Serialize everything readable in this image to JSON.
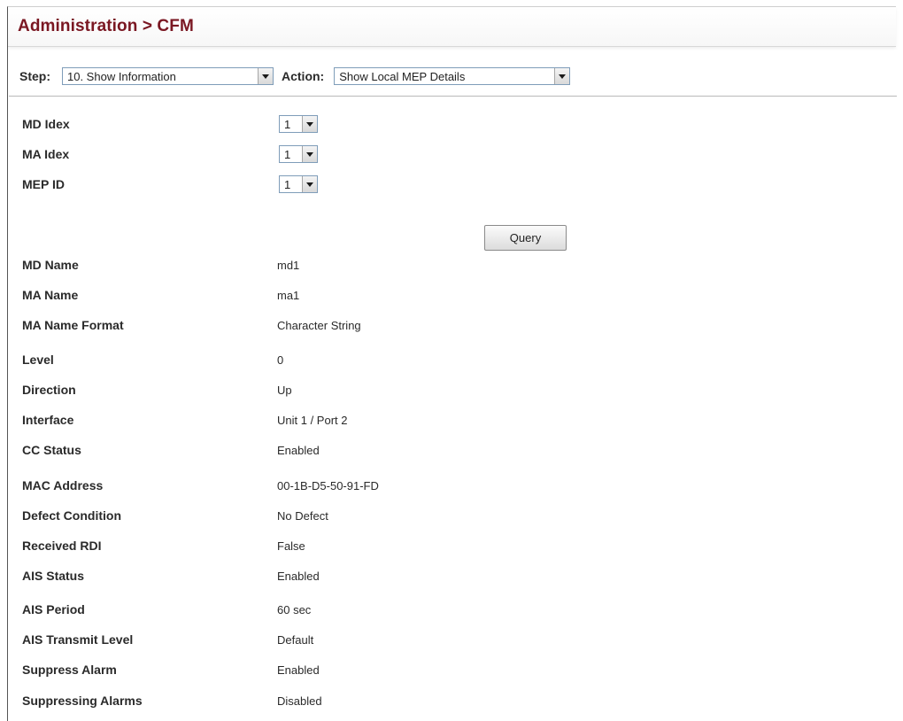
{
  "header": {
    "title": "Administration > CFM"
  },
  "toolbar": {
    "step_label": "Step:",
    "step_value": "10. Show Information",
    "action_label": "Action:",
    "action_value": "Show Local MEP Details"
  },
  "form": {
    "md_index_label": "MD Idex",
    "md_index_value": "1",
    "ma_index_label": "MA Idex",
    "ma_index_value": "1",
    "mep_id_label": "MEP ID",
    "mep_id_value": "1",
    "query_label": "Query"
  },
  "details": [
    {
      "label": "MD Name",
      "value": "md1"
    },
    {
      "label": "MA Name",
      "value": "ma1"
    },
    {
      "label": "MA Name Format",
      "value": "Character String"
    },
    {
      "label": "Level",
      "value": "0"
    },
    {
      "label": "Direction",
      "value": "Up"
    },
    {
      "label": "Interface",
      "value": "Unit 1 / Port 2"
    },
    {
      "label": "CC Status",
      "value": "Enabled"
    },
    {
      "label": "MAC Address",
      "value": "00-1B-D5-50-91-FD"
    },
    {
      "label": "Defect Condition",
      "value": "No Defect"
    },
    {
      "label": "Received RDI",
      "value": "False"
    },
    {
      "label": "AIS Status",
      "value": "Enabled"
    },
    {
      "label": "AIS Period",
      "value": "60 sec"
    },
    {
      "label": "AIS Transmit Level",
      "value": "Default"
    },
    {
      "label": "Suppress Alarm",
      "value": "Enabled"
    },
    {
      "label": "Suppressing Alarms",
      "value": "Disabled"
    }
  ],
  "colors": {
    "title": "#7a1722",
    "select_border": "#7f9db9"
  },
  "icons": {
    "dropdown": "chevron-down-icon"
  }
}
